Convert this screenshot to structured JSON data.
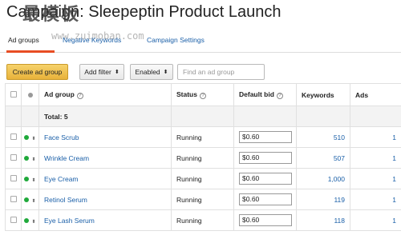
{
  "page": {
    "title": "Campaign: Sleepeptin Product Launch",
    "watermark": "最模板",
    "watermark_url": "www.zuimoban.com"
  },
  "tabs": [
    {
      "label": "Ad groups",
      "active": true
    },
    {
      "label": "Negative Keywords",
      "active": false
    },
    {
      "label": "Campaign Settings",
      "active": false
    }
  ],
  "toolbar": {
    "create_label": "Create ad group",
    "filter_label": "Add filter",
    "enabled_label": "Enabled",
    "search_placeholder": "Find an ad group"
  },
  "table": {
    "headers": {
      "ad_group": "Ad group",
      "status": "Status",
      "default_bid": "Default bid",
      "keywords": "Keywords",
      "ads": "Ads"
    },
    "total_label": "Total: 5",
    "rows": [
      {
        "name": "Face Scrub",
        "status": "Running",
        "bid": "$0.60",
        "keywords": "510",
        "ads": "1"
      },
      {
        "name": "Wrinkle Cream",
        "status": "Running",
        "bid": "$0.60",
        "keywords": "507",
        "ads": "1"
      },
      {
        "name": "Eye Cream",
        "status": "Running",
        "bid": "$0.60",
        "keywords": "1,000",
        "ads": "1"
      },
      {
        "name": "Retinol Serum",
        "status": "Running",
        "bid": "$0.60",
        "keywords": "119",
        "ads": "1"
      },
      {
        "name": "Eye Lash Serum",
        "status": "Running",
        "bid": "$0.60",
        "keywords": "118",
        "ads": "1"
      }
    ]
  },
  "colors": {
    "accent_orange": "#e84d23",
    "link_blue": "#1a5fa8",
    "status_green": "#1fa93a",
    "primary_button": "#e8b23a"
  }
}
